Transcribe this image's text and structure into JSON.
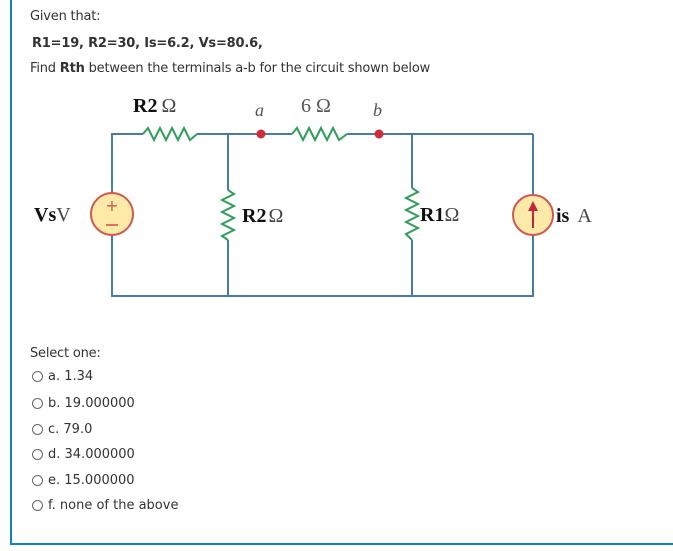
{
  "question": {
    "given_label": "Given that:",
    "values_text": "R1=19, R2=30, Is=6.2, Vs=80.6,",
    "find_prefix": "Find ",
    "find_bold": "Rth",
    "find_suffix": " between the terminals a-b for the circuit shown below"
  },
  "circuit": {
    "top_left_resistor_label": "R2 Ω",
    "node_a_label": "a",
    "middle_resistor_label": "6 Ω",
    "node_b_label": "b",
    "voltage_source_label": "VsV",
    "vertical_r2_label": "R2 Ω",
    "vertical_r1_label": "R1Ω",
    "current_source_label_bold": "is",
    "current_source_label_unit": "A",
    "colors": {
      "wire": "#4a7aa8",
      "resistor": "#2e9e5a",
      "node": "#d12b3a",
      "source_fill": "#fde9a8",
      "source_stroke": "#d1574f"
    }
  },
  "answers": {
    "select_label": "Select one:",
    "options": [
      {
        "label": "a. 1.34",
        "selected": false
      },
      {
        "label": "b. 19.000000",
        "selected": false
      },
      {
        "label": "c. 79.0",
        "selected": false
      },
      {
        "label": "d. 34.000000",
        "selected": false
      },
      {
        "label": "e. 15.000000",
        "selected": false
      },
      {
        "label": "f. none of the above",
        "selected": false
      }
    ]
  }
}
